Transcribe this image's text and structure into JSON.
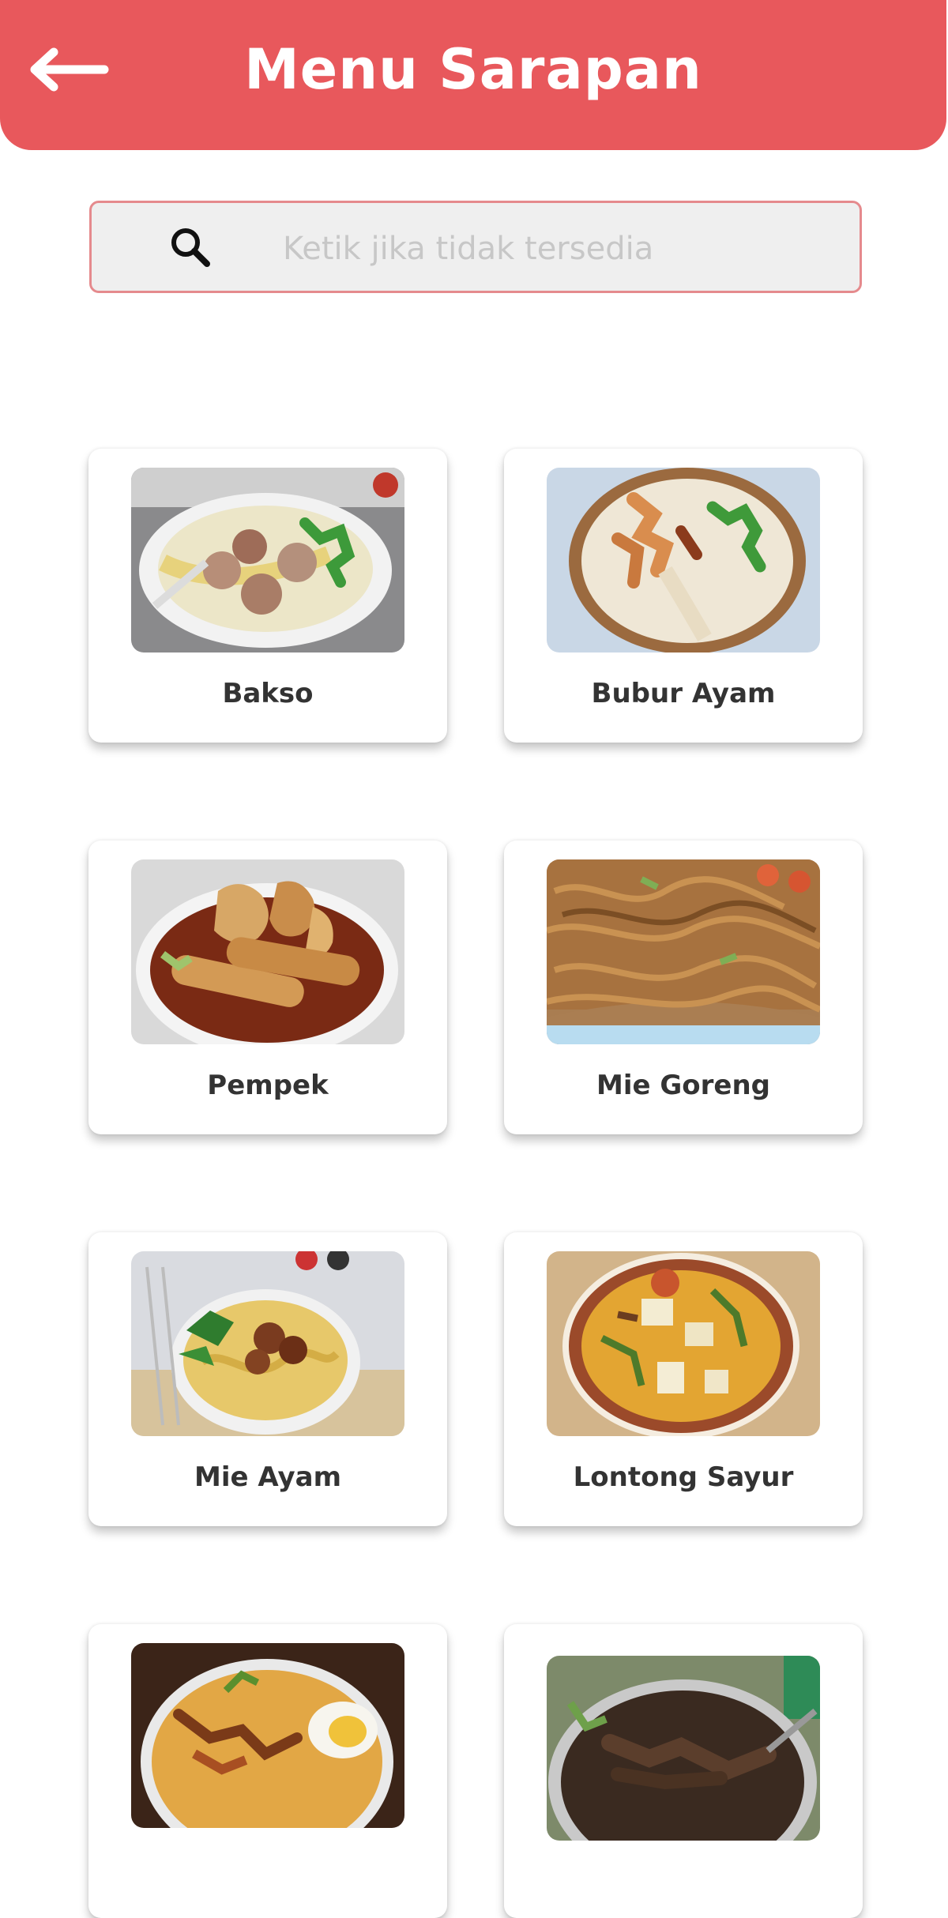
{
  "header": {
    "title": "Menu Sarapan",
    "back_icon": "arrow-left-icon",
    "background_color": "#e8585c"
  },
  "search": {
    "placeholder": "Ketik jika tidak tersedia",
    "icon": "search-icon",
    "value": ""
  },
  "menu": {
    "items": [
      {
        "label": "Bakso"
      },
      {
        "label": "Bubur Ayam"
      },
      {
        "label": "Pempek"
      },
      {
        "label": "Mie Goreng"
      },
      {
        "label": "Mie Ayam"
      },
      {
        "label": "Lontong Sayur"
      },
      {
        "label": ""
      },
      {
        "label": ""
      }
    ]
  }
}
